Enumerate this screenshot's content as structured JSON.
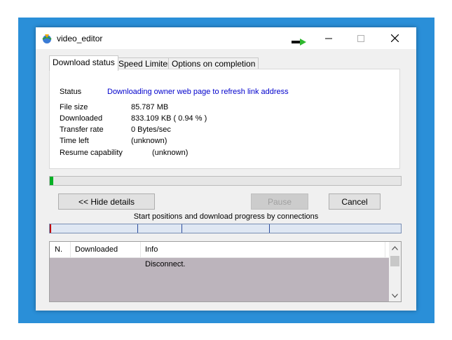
{
  "window": {
    "title": "video_editor"
  },
  "tabs": [
    {
      "label": "Download status"
    },
    {
      "label": "Speed Limiter"
    },
    {
      "label": "Options on completion"
    }
  ],
  "status": {
    "status_label": "Status",
    "status_value": "Downloading owner web page to refresh link address",
    "file_size_label": "File size",
    "file_size_value": "85.787  MB",
    "downloaded_label": "Downloaded",
    "downloaded_value": "833.109  KB  ( 0.94 % )",
    "transfer_rate_label": "Transfer rate",
    "transfer_rate_value": "0  Bytes/sec",
    "time_left_label": "Time left",
    "time_left_value": "(unknown)",
    "resume_label": "Resume capability",
    "resume_value": "(unknown)",
    "status_color": "#0000cc"
  },
  "progress": {
    "fraction": 0.0094
  },
  "buttons": {
    "hide_details": "<< Hide details",
    "pause": "Pause",
    "cancel": "Cancel"
  },
  "connections": {
    "caption": "Start positions and download progress by connections",
    "start_fractions": [
      0.0,
      0.25,
      0.375,
      0.625
    ]
  },
  "grid": {
    "columns": [
      "N.",
      "Downloaded",
      "Info"
    ],
    "rows": [
      {
        "n": "",
        "downloaded": "",
        "info": "Disconnect."
      }
    ]
  },
  "icons": {
    "app": "idm-globe-icon",
    "arrow": "green-arrow-icon",
    "minimize": "minimize-icon",
    "maximize": "maximize-icon",
    "close": "close-icon"
  },
  "colors": {
    "frame": "#2a8fd8",
    "grid_bg": "#bcb4bc"
  }
}
